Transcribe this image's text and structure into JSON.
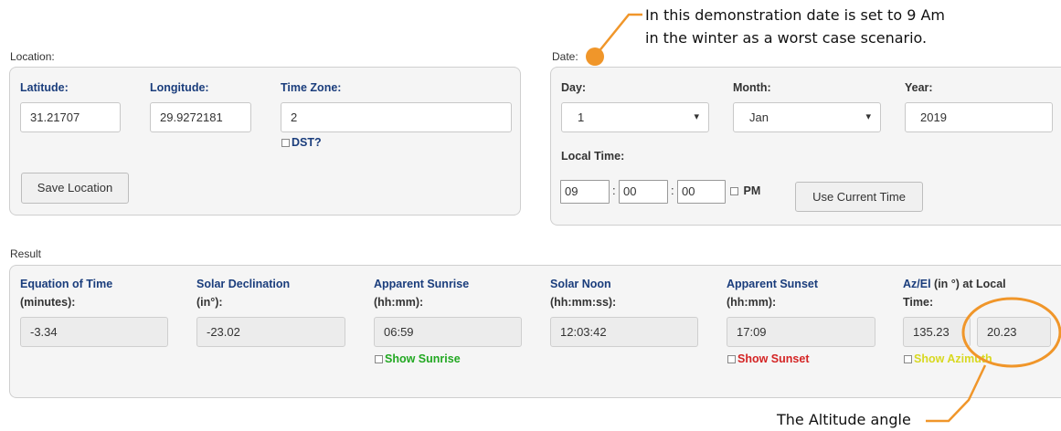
{
  "location": {
    "section_label": "Location:",
    "latitude_label": "Latitude:",
    "latitude_value": "31.21707",
    "longitude_label": "Longitude:",
    "longitude_value": "29.9272181",
    "timezone_label": "Time Zone:",
    "timezone_value": "2",
    "dst_label": "DST?",
    "save_button": "Save Location"
  },
  "date": {
    "section_label": "Date:",
    "day_label": "Day:",
    "day_value": "1",
    "month_label": "Month:",
    "month_value": "Jan",
    "year_label": "Year:",
    "year_value": "2019",
    "local_time_label": "Local Time:",
    "hour": "09",
    "minute": "00",
    "second": "00",
    "pm_label": "PM",
    "use_current_time_button": "Use Current Time"
  },
  "result": {
    "section_label": "Result",
    "eot_label_1": "Equation of Time",
    "eot_label_2": "(minutes):",
    "eot_value": "-3.34",
    "decl_label_1": "Solar Declination",
    "decl_label_2": "(in°):",
    "decl_value": "-23.02",
    "sunrise_label_1": "Apparent Sunrise",
    "sunrise_label_2": "(hh:mm):",
    "sunrise_value": "06:59",
    "show_sunrise": "Show Sunrise",
    "noon_label_1": "Solar Noon",
    "noon_label_2": "(hh:mm:ss):",
    "noon_value": "12:03:42",
    "sunset_label_1": "Apparent Sunset",
    "sunset_label_2": "(hh:mm):",
    "sunset_value": "17:09",
    "show_sunset": "Show Sunset",
    "azel_label_1a": "Az/El",
    "azel_label_1b": " (in °) at Local",
    "azel_label_2": "Time:",
    "azimuth_value": "135.23",
    "elevation_value": "20.23",
    "show_azimuth": "Show Azimuth"
  },
  "annotations": {
    "top_line_1": "In this demonstration date is set to 9 Am",
    "top_line_2": "in the winter as a worst case scenario.",
    "bottom": "The Altitude angle"
  },
  "colors": {
    "label_blue": "#1a3d7c",
    "annotation_orange": "#f0962a",
    "sunrise_green": "#22a822",
    "sunset_red": "#d42424",
    "azimuth_yellow": "#d8d820"
  }
}
